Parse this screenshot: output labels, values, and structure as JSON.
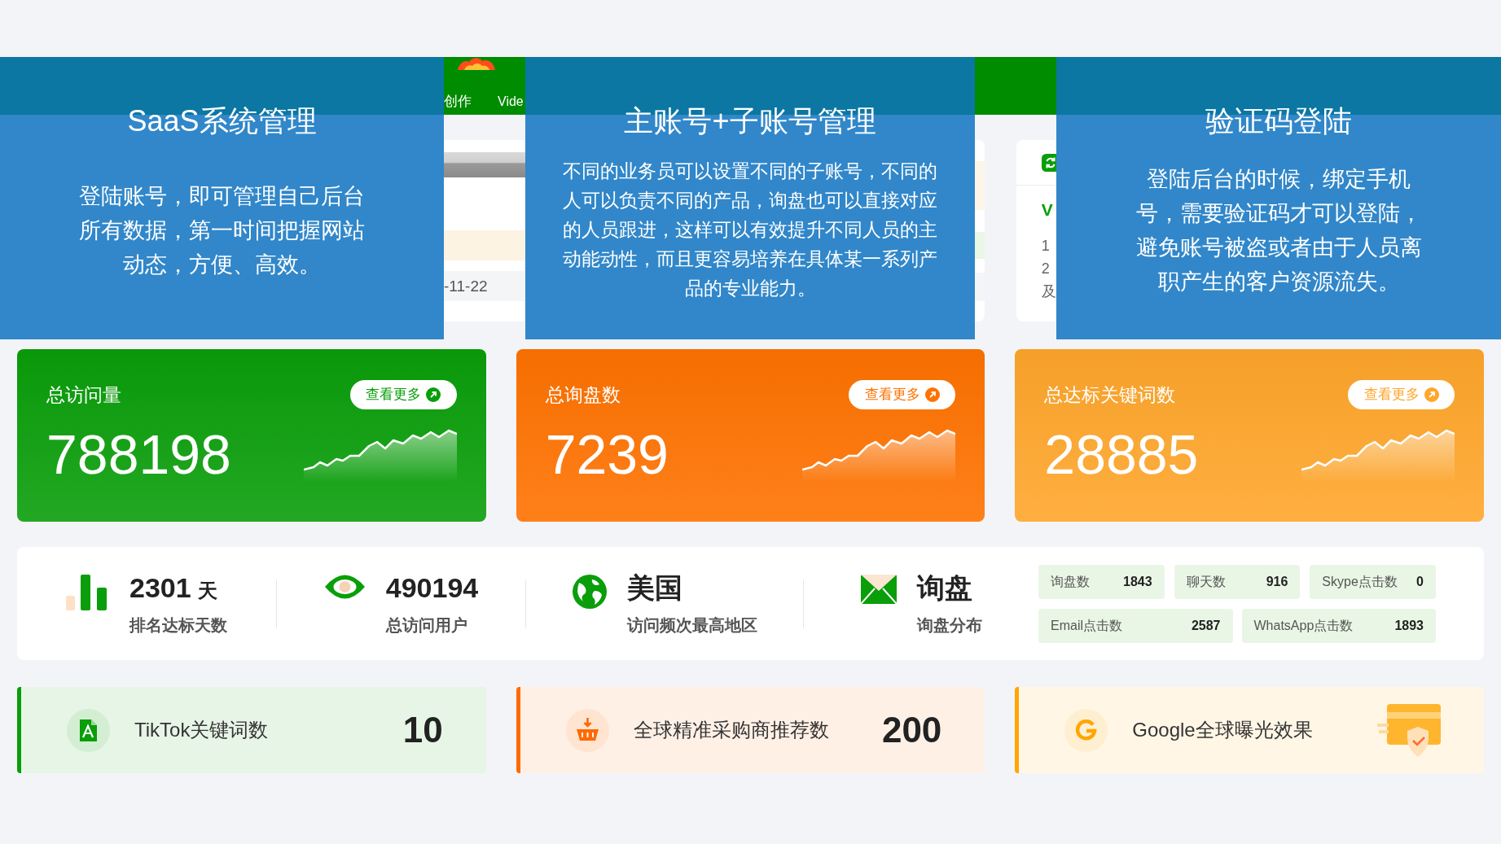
{
  "nav_bar": {
    "items": [
      {
        "label": "创作"
      },
      {
        "label": "Vide"
      }
    ]
  },
  "company_card": {
    "order_time": "-11-22"
  },
  "update_log": {
    "version": "V",
    "lines": [
      "1",
      "2",
      "及"
    ]
  },
  "feature_panels": [
    {
      "title": "SaaS系统管理",
      "text": "登陆账号，即可管理自己后台所有数据，第一时间把握网站动态，方便、高效。"
    },
    {
      "title": "主账号+子账号管理",
      "text": "不同的业务员可以设置不同的子账号，不同的人可以负责不同的产品，询盘也可以直接对应的人员跟进，这样可以有效提升不同人员的主动能动性，而且更容易培养在具体某一系列产品的专业能力。"
    },
    {
      "title": "验证码登陆",
      "text": "登陆后台的时候，绑定手机号，需要验证码才可以登陆，避免账号被盗或者由于人员离职产生的客户资源流失。"
    }
  ],
  "stat_cards": [
    {
      "title": "总访问量",
      "value": "788198",
      "more_button": "查看更多",
      "color": "#0a9e0a"
    },
    {
      "title": "总询盘数",
      "value": "7239",
      "more_button": "查看更多",
      "color": "#ff7200"
    },
    {
      "title": "总达标关键词数",
      "value": "28885",
      "more_button": "查看更多",
      "color": "#ffa62b"
    }
  ],
  "summary_strip": {
    "items": [
      {
        "value": "2301",
        "unit": "天",
        "label": "排名达标天数"
      },
      {
        "value": "490194",
        "label": "总访问用户"
      },
      {
        "value": "美国",
        "label": "访问频次最高地区"
      },
      {
        "value": "询盘",
        "label": "询盘分布"
      }
    ],
    "counters": [
      [
        {
          "label": "询盘数",
          "value": "1843"
        },
        {
          "label": "聊天数",
          "value": "916"
        },
        {
          "label": "Skype点击数",
          "value": "0"
        }
      ],
      [
        {
          "label": "Email点击数",
          "value": "2587"
        },
        {
          "label": "WhatsApp点击数",
          "value": "1893"
        }
      ]
    ]
  },
  "feature_cards": [
    {
      "label": "TikTok关键词数",
      "value": "10",
      "color": "#0a9e0a"
    },
    {
      "label": "全球精准采购商推荐数",
      "value": "200",
      "color": "#ff6a00"
    },
    {
      "label": "Google全球曝光效果",
      "color": "#ffa500"
    }
  ]
}
